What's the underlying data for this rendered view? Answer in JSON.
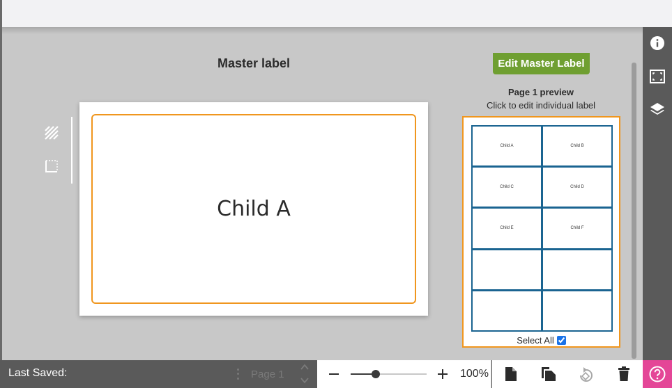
{
  "workspace": {
    "master_title": "Master label",
    "canvas_label_text": "Child A"
  },
  "preview": {
    "edit_master_label": "Edit Master Label",
    "title": "Page 1 preview",
    "subtitle": "Click to edit individual label",
    "cells": [
      "Child A",
      "Child B",
      "Child C",
      "Child D",
      "Child E",
      "Child F",
      "",
      "",
      "",
      ""
    ],
    "select_all_label": "Select All",
    "select_all_checked": true
  },
  "bottom_bar": {
    "last_saved_label": "Last Saved:",
    "page_label": "Page 1",
    "zoom_percent": 100,
    "zoom_slider_fraction": 0.33,
    "zoom_value": "100%"
  },
  "right_rail": {
    "icons": [
      "info-icon",
      "fit-to-screen-icon",
      "layers-icon"
    ]
  },
  "actions": {
    "icons": [
      "new-page-icon",
      "duplicate-page-icon",
      "rotate-icon",
      "delete-icon"
    ]
  },
  "colors": {
    "accent_orange": "#f0961e",
    "primary_green": "#6f9f31",
    "grid_blue": "#1a6491",
    "help_pink": "#e44697",
    "panel_gray": "#5a5a5a"
  }
}
